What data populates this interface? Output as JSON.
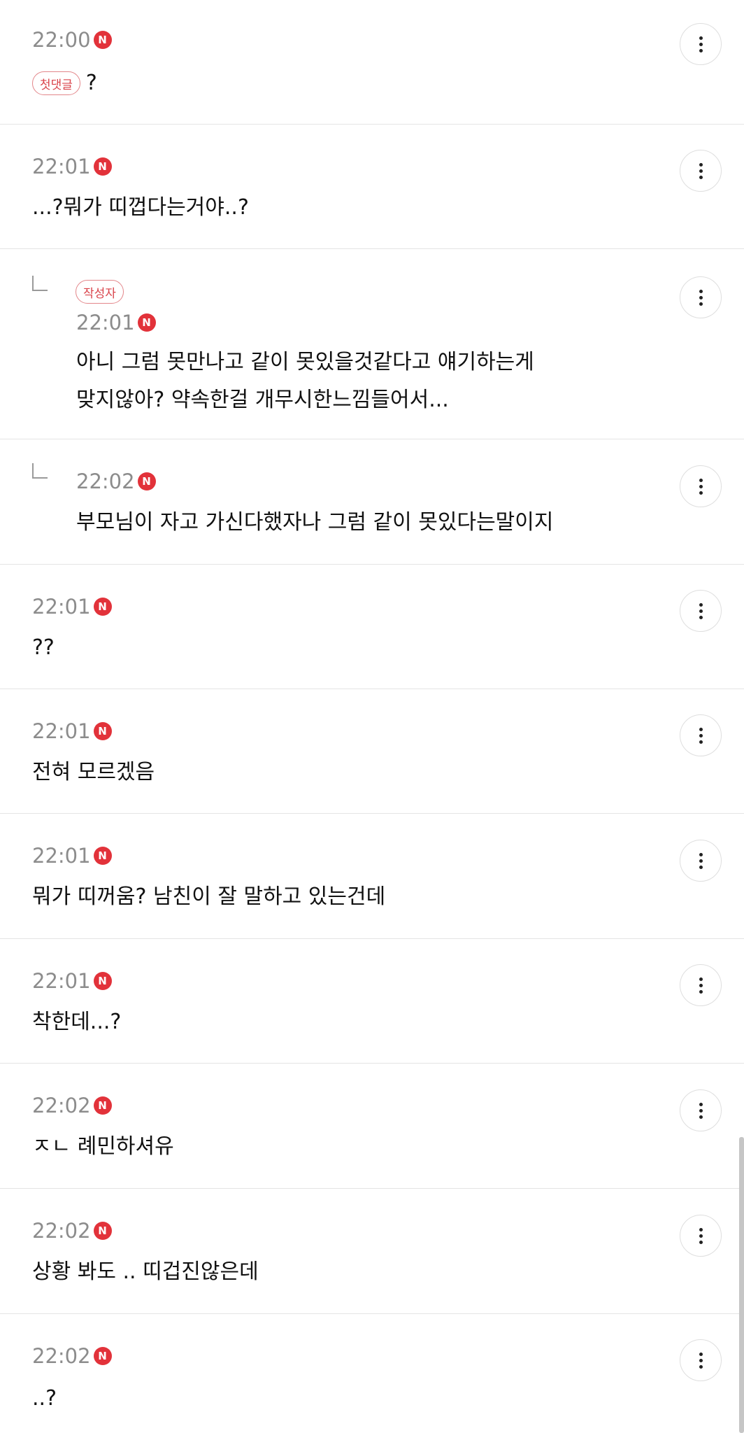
{
  "new_badge": "N",
  "comments": [
    {
      "time": "22:00",
      "tag": "첫댓글",
      "text": "?"
    },
    {
      "time": "22:01",
      "text": "...?뭐가 띠껍다는거야..?"
    },
    {
      "time": "22:01",
      "tag": "작성자",
      "lines": [
        "아니 그럼 못만나고 같이 못있을것같다고 얘기하는게",
        "맞지않아? 약속한걸 개무시한느낌들어서..."
      ],
      "reply": true
    },
    {
      "time": "22:02",
      "text": "부모님이 자고 가신다했자나 그럼 같이 못있다는말이지",
      "reply": true
    },
    {
      "time": "22:01",
      "text": "??"
    },
    {
      "time": "22:01",
      "text": "전혀 모르겠음"
    },
    {
      "time": "22:01",
      "text": "뭐가 띠꺼움? 남친이 잘 말하고 있는건데"
    },
    {
      "time": "22:01",
      "text": "착한데...?"
    },
    {
      "time": "22:02",
      "text": "ㅈㄴ 례민하셔유"
    },
    {
      "time": "22:02",
      "text": "상황 봐도 .. 띠겁진않은데"
    },
    {
      "time": "22:02",
      "text": "..?"
    }
  ]
}
